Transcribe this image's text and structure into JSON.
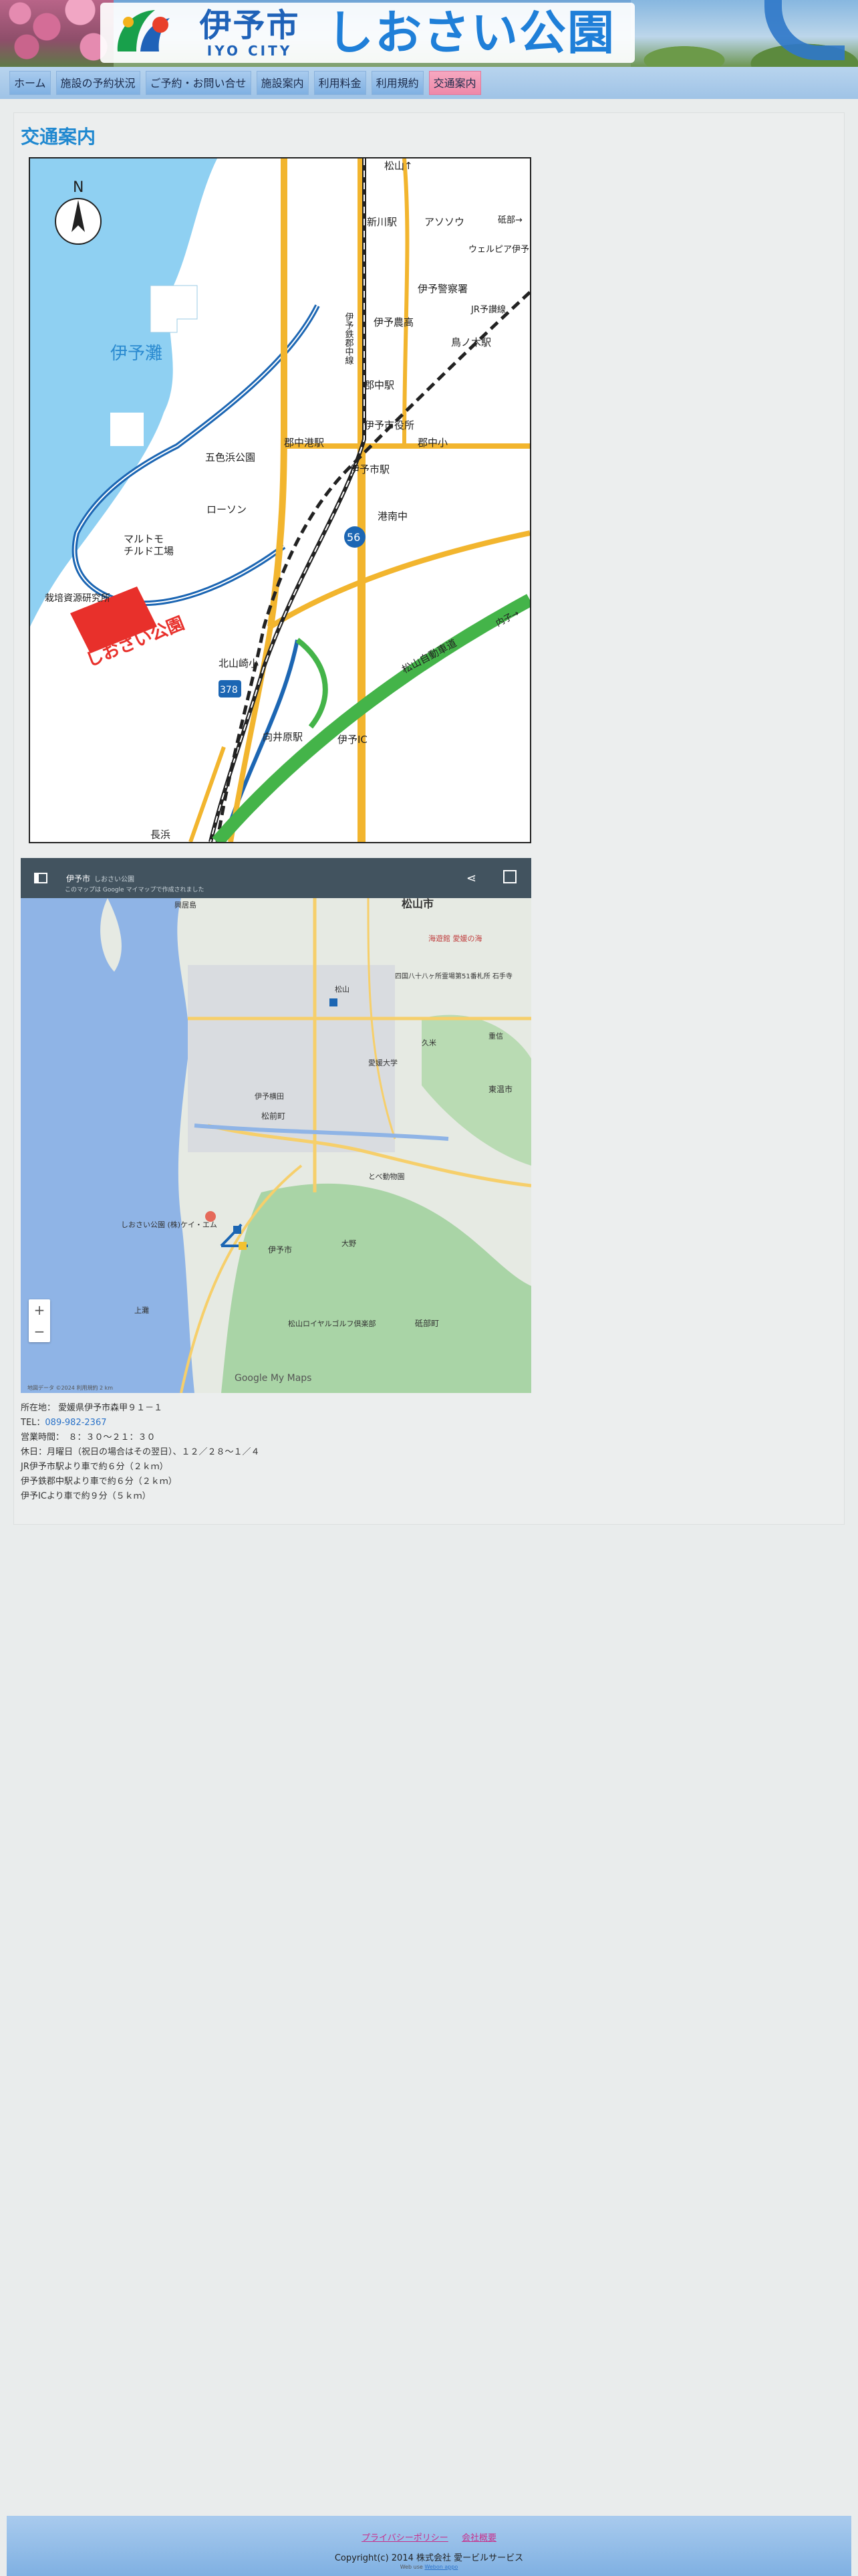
{
  "header": {
    "logo_city_ja": "伊予市",
    "logo_city_en": "IYO CITY",
    "logo_park": "しおさい公園"
  },
  "nav": {
    "items": [
      {
        "label": "ホーム"
      },
      {
        "label": "施設の予約状況"
      },
      {
        "label": "ご予約・お問い合せ"
      },
      {
        "label": "施設案内"
      },
      {
        "label": "利用料金"
      },
      {
        "label": "利用規約"
      },
      {
        "label": "交通案内",
        "active": true
      }
    ]
  },
  "page": {
    "title": "交通案内"
  },
  "illustration_map": {
    "labels": {
      "north": "N",
      "matsuyama": "松山↑",
      "shinkawa": "新川駅",
      "ason": "アソソウ",
      "sunabe": "砥部→",
      "welpia": "ウェルピア伊予",
      "iyo_police": "伊予警察署",
      "iyo_sea": "伊予灘",
      "iyo_tetsu": "伊予鉄郡中線",
      "iyo_nouko": "伊予農高",
      "torinoki": "鳥ノ木駅",
      "jr_yosan": "JR予讃線",
      "gunchu_st": "郡中駅",
      "iyo_city_hall": "伊予市役所",
      "goshikihama": "五色浜公園",
      "gunchu_port": "郡中港駅",
      "gunchu_elem": "郡中小",
      "iyoshi_st": "伊予市駅",
      "lawson": "ローソン",
      "route56": "56",
      "minatominami": "港南中",
      "marutomo": "マルトモ",
      "chilled": "チルド工場",
      "fisheries": "栽培資源研究所",
      "park": "しおさい公園",
      "kitayamazaki": "北山崎小",
      "route378": "378",
      "matsuyama_exp": "松山自動車道",
      "uchiko": "内子→",
      "mukaibara": "向井原駅",
      "iyo_ic": "伊予IC",
      "nagahama": "長浜"
    }
  },
  "google_map": {
    "header_title": "伊予市",
    "header_sub": "しおさい公園",
    "header_note": "このマップは Google マイマップで作成されました",
    "labels": {
      "kogoshima": "興居島",
      "matsuyama_city": "松山市",
      "sea_museum": "海遊館 愛媛の海",
      "shikoku_88": "四国八十八ヶ所霊場第51番札所 石手寺",
      "matsuyama_station": "松山",
      "kume": "久米",
      "shigenobu": "重信",
      "ehime_u": "愛媛大学",
      "iyo_yokota": "伊予横田",
      "matsumae": "松前町",
      "toon": "東温市",
      "tobe_zoo": "とべ動物園",
      "tobe": "砥部町",
      "park_pin": "しおさい公園 (株)ケイ・エム",
      "iyo_city": "伊予市",
      "ono": "大野",
      "kamo": "上灘",
      "matsuyama_gc": "松山ロイヤルゴルフ倶楽部",
      "brand": "Google My Maps"
    },
    "attribution": "地図データ ©2024 利用規約 2 km",
    "zoom_in": "+",
    "zoom_out": "−"
  },
  "info": {
    "address_label": "所在地：",
    "address": "愛媛県伊予市森甲９１－１",
    "tel_label": "TEL：",
    "tel": "089-982-2367",
    "hours": "営業時間：　８：３０～２１：３０",
    "closed": "休日：月曜日（祝日の場合はその翌日）、１２／２８～１／４",
    "access_jr": "JR伊予市駅より車で約６分（２ｋｍ）",
    "access_gunchu": "伊予鉄郡中駅より車で約６分（２ｋｍ）",
    "access_ic": "伊予ICより車で約９分（５ｋｍ）"
  },
  "footer": {
    "privacy": "プライバシーポリシー",
    "company": "会社概要",
    "copyright": "Copyright(c) 2014 株式会社 愛ービルサービス",
    "powered_prefix": "Web use",
    "powered_link": "Webon appo"
  }
}
